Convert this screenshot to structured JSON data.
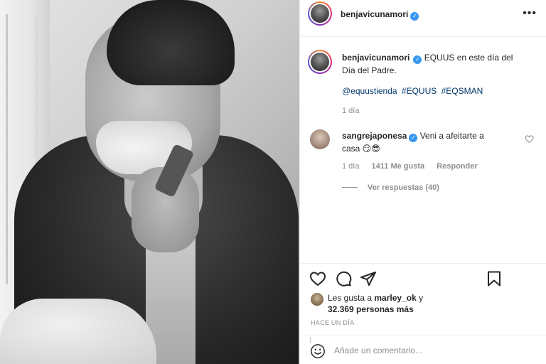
{
  "post": {
    "author": "benjavicunamori",
    "caption_text": "EQUUS en este día del Día del Padre.",
    "hashtags": [
      "@equustienda",
      "#EQUUS",
      "#EQSMAN"
    ],
    "time": "1 día"
  },
  "comment": {
    "author": "sangrejaponesa",
    "text": "Veni a afeitarte a casa 😏😎",
    "time": "1 día",
    "likes": "1411 Me gusta",
    "reply_label": "Responder",
    "view_replies": "Ver respuestas (40)"
  },
  "likes": {
    "prefix": "Les gusta a",
    "user": "marley_ok",
    "joiner": "y",
    "count": "32.369 personas más"
  },
  "time_ago": "HACE UN DÍA",
  "comment_input": {
    "placeholder": "Añade un comentario..."
  },
  "icons": {
    "more": "more-horizontal-icon",
    "verified": "verified-badge-icon",
    "like": "heart-icon",
    "comment": "comment-bubble-icon",
    "share": "paper-plane-icon",
    "save": "bookmark-icon",
    "emoji": "smiley-icon"
  },
  "colors": {
    "verified": "#3897f0",
    "link": "#00376b",
    "muted": "#8e8e8e"
  }
}
